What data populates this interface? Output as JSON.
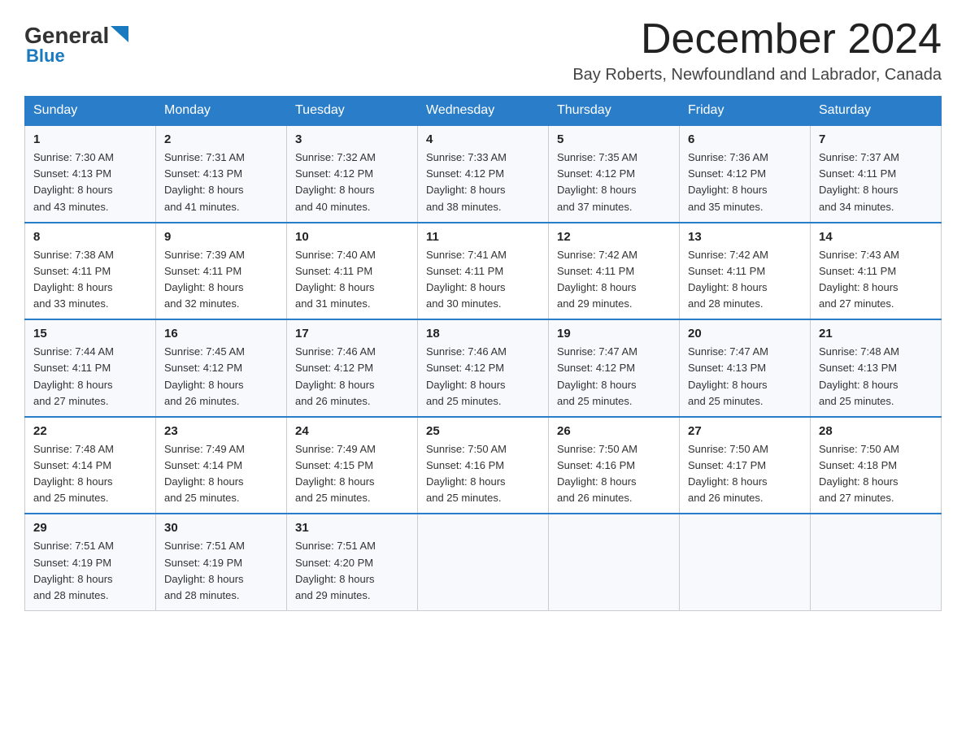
{
  "header": {
    "logo_general": "General",
    "logo_blue": "Blue",
    "month_title": "December 2024",
    "location": "Bay Roberts, Newfoundland and Labrador, Canada"
  },
  "days_of_week": [
    "Sunday",
    "Monday",
    "Tuesday",
    "Wednesday",
    "Thursday",
    "Friday",
    "Saturday"
  ],
  "weeks": [
    [
      {
        "day": "1",
        "sunrise": "7:30 AM",
        "sunset": "4:13 PM",
        "daylight": "8 hours and 43 minutes."
      },
      {
        "day": "2",
        "sunrise": "7:31 AM",
        "sunset": "4:13 PM",
        "daylight": "8 hours and 41 minutes."
      },
      {
        "day": "3",
        "sunrise": "7:32 AM",
        "sunset": "4:12 PM",
        "daylight": "8 hours and 40 minutes."
      },
      {
        "day": "4",
        "sunrise": "7:33 AM",
        "sunset": "4:12 PM",
        "daylight": "8 hours and 38 minutes."
      },
      {
        "day": "5",
        "sunrise": "7:35 AM",
        "sunset": "4:12 PM",
        "daylight": "8 hours and 37 minutes."
      },
      {
        "day": "6",
        "sunrise": "7:36 AM",
        "sunset": "4:12 PM",
        "daylight": "8 hours and 35 minutes."
      },
      {
        "day": "7",
        "sunrise": "7:37 AM",
        "sunset": "4:11 PM",
        "daylight": "8 hours and 34 minutes."
      }
    ],
    [
      {
        "day": "8",
        "sunrise": "7:38 AM",
        "sunset": "4:11 PM",
        "daylight": "8 hours and 33 minutes."
      },
      {
        "day": "9",
        "sunrise": "7:39 AM",
        "sunset": "4:11 PM",
        "daylight": "8 hours and 32 minutes."
      },
      {
        "day": "10",
        "sunrise": "7:40 AM",
        "sunset": "4:11 PM",
        "daylight": "8 hours and 31 minutes."
      },
      {
        "day": "11",
        "sunrise": "7:41 AM",
        "sunset": "4:11 PM",
        "daylight": "8 hours and 30 minutes."
      },
      {
        "day": "12",
        "sunrise": "7:42 AM",
        "sunset": "4:11 PM",
        "daylight": "8 hours and 29 minutes."
      },
      {
        "day": "13",
        "sunrise": "7:42 AM",
        "sunset": "4:11 PM",
        "daylight": "8 hours and 28 minutes."
      },
      {
        "day": "14",
        "sunrise": "7:43 AM",
        "sunset": "4:11 PM",
        "daylight": "8 hours and 27 minutes."
      }
    ],
    [
      {
        "day": "15",
        "sunrise": "7:44 AM",
        "sunset": "4:11 PM",
        "daylight": "8 hours and 27 minutes."
      },
      {
        "day": "16",
        "sunrise": "7:45 AM",
        "sunset": "4:12 PM",
        "daylight": "8 hours and 26 minutes."
      },
      {
        "day": "17",
        "sunrise": "7:46 AM",
        "sunset": "4:12 PM",
        "daylight": "8 hours and 26 minutes."
      },
      {
        "day": "18",
        "sunrise": "7:46 AM",
        "sunset": "4:12 PM",
        "daylight": "8 hours and 25 minutes."
      },
      {
        "day": "19",
        "sunrise": "7:47 AM",
        "sunset": "4:12 PM",
        "daylight": "8 hours and 25 minutes."
      },
      {
        "day": "20",
        "sunrise": "7:47 AM",
        "sunset": "4:13 PM",
        "daylight": "8 hours and 25 minutes."
      },
      {
        "day": "21",
        "sunrise": "7:48 AM",
        "sunset": "4:13 PM",
        "daylight": "8 hours and 25 minutes."
      }
    ],
    [
      {
        "day": "22",
        "sunrise": "7:48 AM",
        "sunset": "4:14 PM",
        "daylight": "8 hours and 25 minutes."
      },
      {
        "day": "23",
        "sunrise": "7:49 AM",
        "sunset": "4:14 PM",
        "daylight": "8 hours and 25 minutes."
      },
      {
        "day": "24",
        "sunrise": "7:49 AM",
        "sunset": "4:15 PM",
        "daylight": "8 hours and 25 minutes."
      },
      {
        "day": "25",
        "sunrise": "7:50 AM",
        "sunset": "4:16 PM",
        "daylight": "8 hours and 25 minutes."
      },
      {
        "day": "26",
        "sunrise": "7:50 AM",
        "sunset": "4:16 PM",
        "daylight": "8 hours and 26 minutes."
      },
      {
        "day": "27",
        "sunrise": "7:50 AM",
        "sunset": "4:17 PM",
        "daylight": "8 hours and 26 minutes."
      },
      {
        "day": "28",
        "sunrise": "7:50 AM",
        "sunset": "4:18 PM",
        "daylight": "8 hours and 27 minutes."
      }
    ],
    [
      {
        "day": "29",
        "sunrise": "7:51 AM",
        "sunset": "4:19 PM",
        "daylight": "8 hours and 28 minutes."
      },
      {
        "day": "30",
        "sunrise": "7:51 AM",
        "sunset": "4:19 PM",
        "daylight": "8 hours and 28 minutes."
      },
      {
        "day": "31",
        "sunrise": "7:51 AM",
        "sunset": "4:20 PM",
        "daylight": "8 hours and 29 minutes."
      },
      null,
      null,
      null,
      null
    ]
  ],
  "labels": {
    "sunrise": "Sunrise:",
    "sunset": "Sunset:",
    "daylight": "Daylight:"
  }
}
